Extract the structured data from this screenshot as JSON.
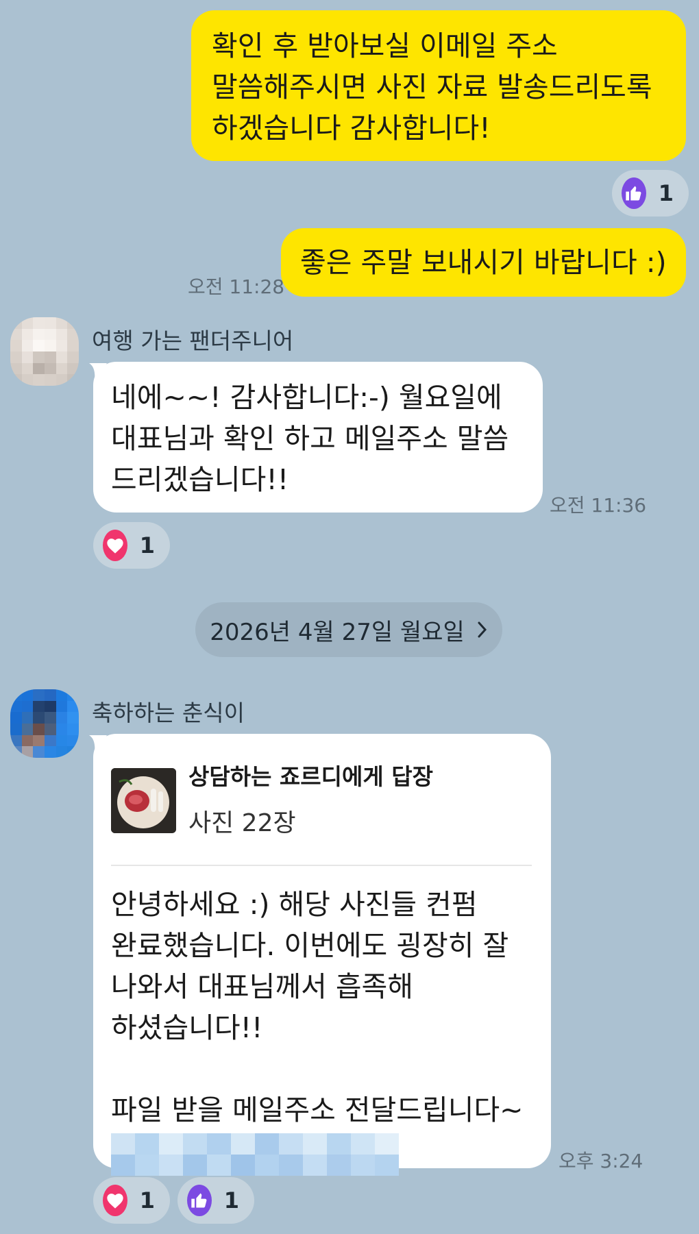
{
  "messages": {
    "out1": {
      "text": "확인 후 받아보실 이메일 주소\n말씀해주시면 사진 자료 발송드리도록\n하겠습니다 감사합니다!",
      "reaction": {
        "icon": "thumbs-up-icon",
        "count": "1"
      }
    },
    "out2": {
      "text": "좋은 주말 보내시기 바랍니다 :)",
      "time": "오전 11:28"
    },
    "in1": {
      "sender": "여행 가는 팬더주니어",
      "text": "네에~~! 감사합니다:-) 월요일에\n대표님과 확인 하고 메일주소 말씀\n드리겠습니다!!",
      "time": "오전 11:36",
      "reaction": {
        "icon": "heart-icon",
        "count": "1"
      }
    },
    "date_divider": "2026년 4월 27일 월요일",
    "in2": {
      "sender": "축하하는 춘식이",
      "reply_title": "상담하는 죠르디에게 답장",
      "reply_sub": "사진 22장",
      "text": "안녕하세요 :) 해당 사진들 컨펌\n완료했습니다. 이번에도 굉장히 잘\n나와서 대표님께서 흡족해\n하셨습니다!!\n\n파일 받을 메일주소 전달드립니다~",
      "time": "오후 3:24",
      "reactions": [
        {
          "icon": "heart-icon",
          "count": "1"
        },
        {
          "icon": "thumbs-up-icon",
          "count": "1"
        }
      ]
    }
  },
  "colors": {
    "background": "#abc1d1",
    "outgoing_bubble": "#fee500",
    "incoming_bubble": "#ffffff",
    "thumbs_up": "#7c4ae2",
    "heart": "#f0356d"
  }
}
